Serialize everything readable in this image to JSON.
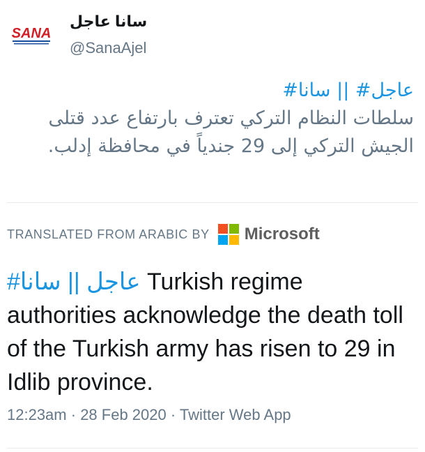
{
  "account": {
    "display_name": "سانا عاجل",
    "handle": "@SanaAjel",
    "avatar_label": "SANA"
  },
  "tweet": {
    "hashtag_1": "عاجل#",
    "separator": " || ",
    "hashtag_2": "سانا#",
    "arabic_body": "سلطات النظام التركي تعترف بارتفاع عدد قتلى الجيش التركي إلى 29 جندياً في محافظة إدلب."
  },
  "translation": {
    "label": "TRANSLATED FROM ARABIC BY",
    "provider": "Microsoft",
    "tag_1": "#سانا",
    "separator": " || ",
    "tag_2": "عاجل",
    "body": " Turkish regime authorities acknowledge the death toll of the Turkish army has risen to 29 in Idlib province."
  },
  "meta": {
    "time": "12:23am",
    "dot": " · ",
    "date": "28 Feb 2020",
    "source": "Twitter Web App"
  },
  "colors": {
    "link": "#1b95e0",
    "secondary_text": "#657786",
    "ms_red": "#f25022",
    "ms_green": "#7fba00",
    "ms_blue": "#00a4ef",
    "ms_yellow": "#ffb900",
    "sana_red": "#d21f26"
  }
}
